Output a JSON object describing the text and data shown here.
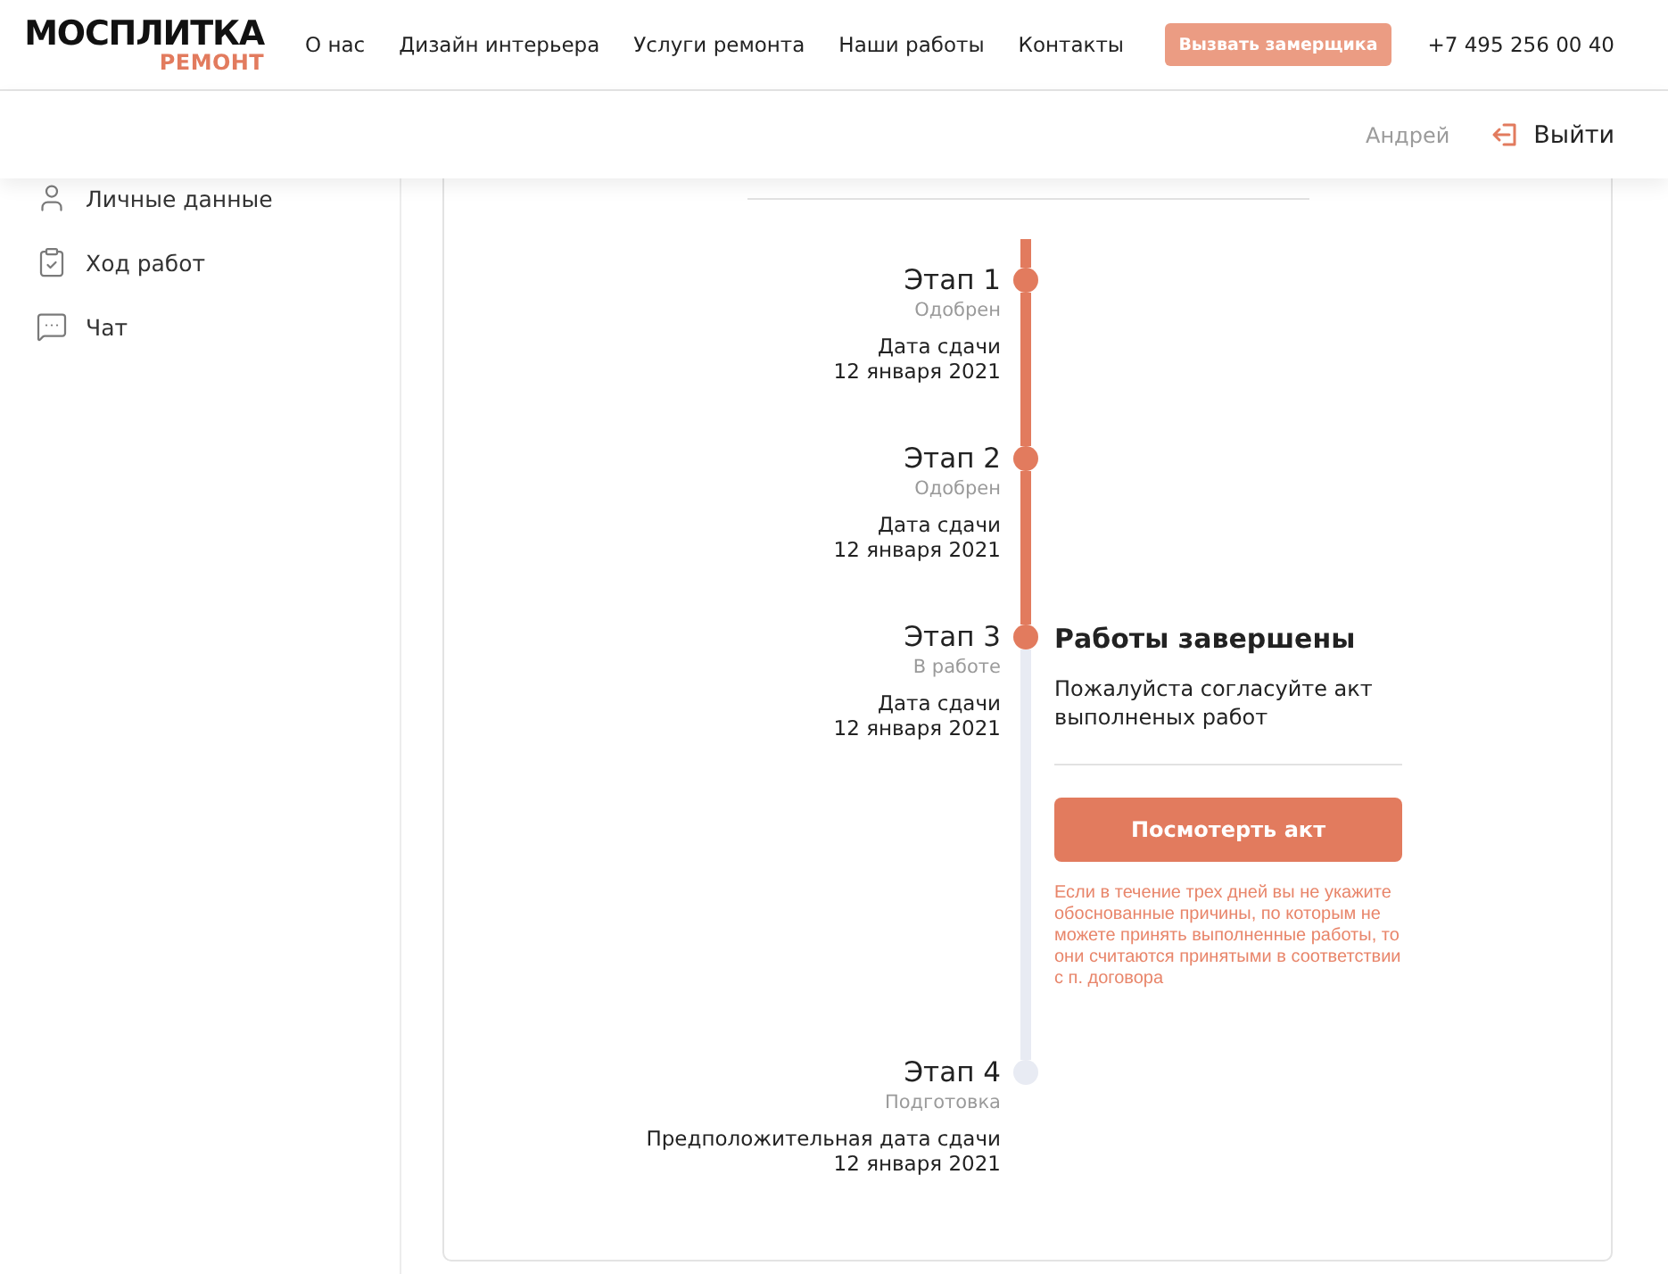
{
  "header": {
    "logo": {
      "name": "МОСПЛИТКА",
      "tagline": "РЕМОНТ"
    },
    "nav": [
      "О нас",
      "Дизайн интерьера",
      "Услуги ремонта",
      "Наши работы",
      "Контакты"
    ],
    "cta_button": "Вызвать замерщика",
    "phone": "+7 495 256 00 40"
  },
  "user_bar": {
    "user_name": "Андрей",
    "logout": "Выйти"
  },
  "sidebar": {
    "items": [
      "Личные данные",
      "Ход работ",
      "Чат"
    ]
  },
  "stages": [
    {
      "title": "Этап 1",
      "status": "Одобрен",
      "reached": true,
      "completed": true,
      "date_label": "Дата сдачи",
      "date": "12 января 2021"
    },
    {
      "title": "Этап 2",
      "status": "Одобрен",
      "reached": true,
      "completed": true,
      "date_label": "Дата сдачи",
      "date": "12 января 2021"
    },
    {
      "title": "Этап 3",
      "status": "В работе",
      "reached": true,
      "completed": false,
      "date_label": "Дата сдачи",
      "date": "12 января 2021",
      "panel": {
        "title": "Работы завершены",
        "text": "Пожалуйста согласуйте акт выполненых работ",
        "button": "Посмотерть акт",
        "note": "Если в течение трех дней вы не укажите обоснованные причины, по которым не можете принять выполненные работы, то они считаются принятыми в соответствии с п. договора"
      }
    },
    {
      "title": "Этап 4",
      "status": "Подготовка",
      "reached": false,
      "completed": false,
      "date_label": "Предположительная дата сдачи",
      "date": "12 января 2021"
    }
  ]
}
